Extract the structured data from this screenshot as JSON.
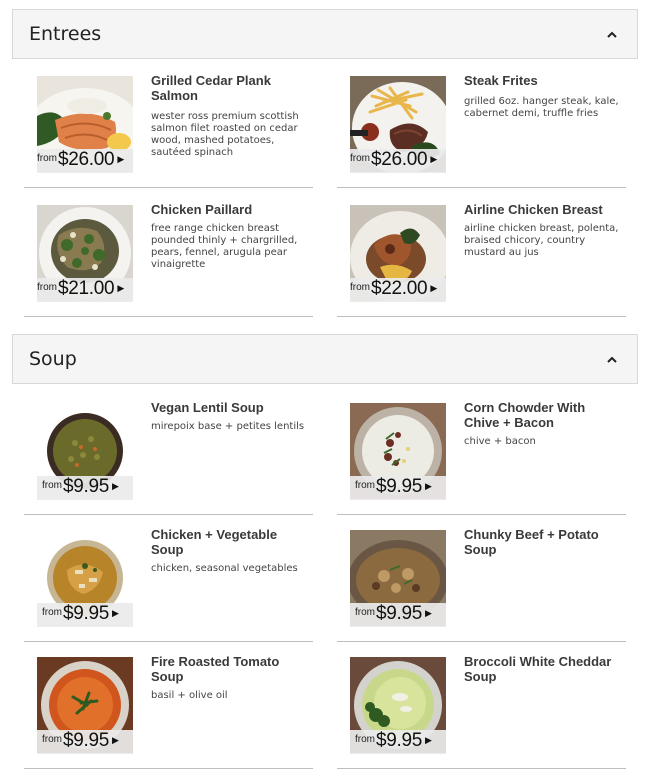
{
  "sections": [
    {
      "title": "Entrees",
      "items": [
        {
          "name": "Grilled Cedar Plank Salmon",
          "description": "wester ross premium scottish salmon filet roasted on cedar wood, mashed potatoes, sautéed spinach",
          "from_label": "from",
          "price": "$26.00",
          "photo": "salmon"
        },
        {
          "name": "Steak Frites",
          "description": "grilled 6oz. hanger steak, kale, cabernet demi, truffle fries",
          "from_label": "from",
          "price": "$26.00",
          "photo": "steak"
        },
        {
          "name": "Chicken Paillard",
          "description": "free range chicken breast pounded thinly + chargrilled, pears, fennel, arugula pear vinaigrette",
          "from_label": "from",
          "price": "$21.00",
          "photo": "paillard"
        },
        {
          "name": "Airline Chicken Breast",
          "description": "airline chicken breast, polenta, braised chicory, country mustard au jus",
          "from_label": "from",
          "price": "$22.00",
          "photo": "airline"
        }
      ]
    },
    {
      "title": "Soup",
      "items": [
        {
          "name": "Vegan Lentil Soup",
          "description": "mirepoix base + petites lentils",
          "from_label": "from",
          "price": "$9.95",
          "photo": "lentil"
        },
        {
          "name": "Corn Chowder With Chive + Bacon",
          "description": "chive + bacon",
          "from_label": "from",
          "price": "$9.95",
          "photo": "chowder"
        },
        {
          "name": "Chicken + Vegetable Soup",
          "description": "chicken, seasonal vegetables",
          "from_label": "from",
          "price": "$9.95",
          "photo": "chickenveg"
        },
        {
          "name": "Chunky Beef + Potato Soup",
          "description": "",
          "from_label": "from",
          "price": "$9.95",
          "photo": "beef"
        },
        {
          "name": "Fire Roasted Tomato Soup",
          "description": "basil + olive oil",
          "from_label": "from",
          "price": "$9.95",
          "photo": "tomato"
        },
        {
          "name": "Broccoli White Cheddar Soup",
          "description": "",
          "from_label": "from",
          "price": "$9.95",
          "photo": "broccoli"
        }
      ]
    }
  ],
  "icons": {
    "collapse": "chevron-up-icon",
    "price_arrow": "caret-right-icon"
  }
}
